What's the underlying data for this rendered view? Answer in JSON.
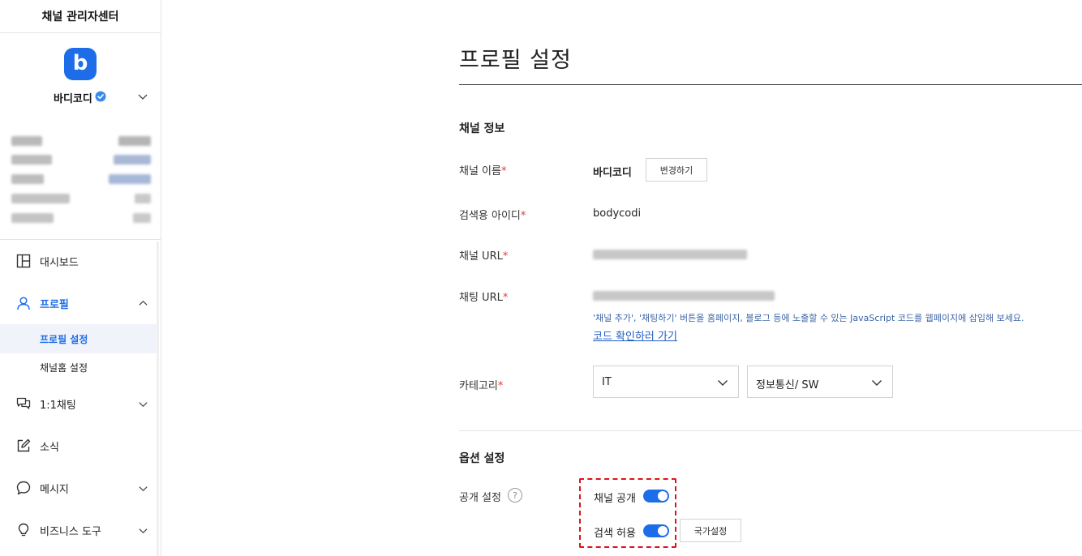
{
  "sidebar": {
    "app_title": "채널 관리자센터",
    "logo_letter": "b",
    "channel_name": "바디코디",
    "nav": [
      {
        "label": "대시보드",
        "icon": "dashboard-icon"
      },
      {
        "label": "프로필",
        "icon": "user-icon",
        "active": true,
        "expanded": true,
        "children": [
          {
            "label": "프로필 설정",
            "active": true
          },
          {
            "label": "채널홈 설정"
          }
        ]
      },
      {
        "label": "1:1채팅",
        "icon": "chat-icon"
      },
      {
        "label": "소식",
        "icon": "edit-icon"
      },
      {
        "label": "메시지",
        "icon": "message-icon"
      },
      {
        "label": "비즈니스 도구",
        "icon": "lightbulb-icon"
      }
    ]
  },
  "main": {
    "title": "프로필 설정",
    "channel_info": {
      "heading": "채널 정보",
      "name_label": "채널 이름",
      "name_value": "바디코디",
      "change_button": "변경하기",
      "search_id_label": "검색용 아이디",
      "search_id_value": "bodycodi",
      "channel_url_label": "채널 URL",
      "chat_url_label": "채팅 URL",
      "hint": "'채널 추가', '채팅하기' 버튼을 홈페이지, 블로그 등에 노출할 수 있는 JavaScript 코드를 웹페이지에 삽입해 보세요.",
      "code_link": "코드 확인하러 가기",
      "category_label": "카테고리",
      "category_1": "IT",
      "category_2": "정보통신/ SW",
      "required_mark": "*"
    },
    "options": {
      "heading": "옵션 설정",
      "visibility_label": "공개 설정",
      "help_glyph": "?",
      "channel_public_label": "채널 공개",
      "channel_public_on": true,
      "search_allow_label": "검색 허용",
      "search_allow_on": true,
      "country_button": "국가설정"
    }
  },
  "colors": {
    "accent": "#1d6de8",
    "required": "#e53935",
    "highlight": "#e0121b"
  }
}
